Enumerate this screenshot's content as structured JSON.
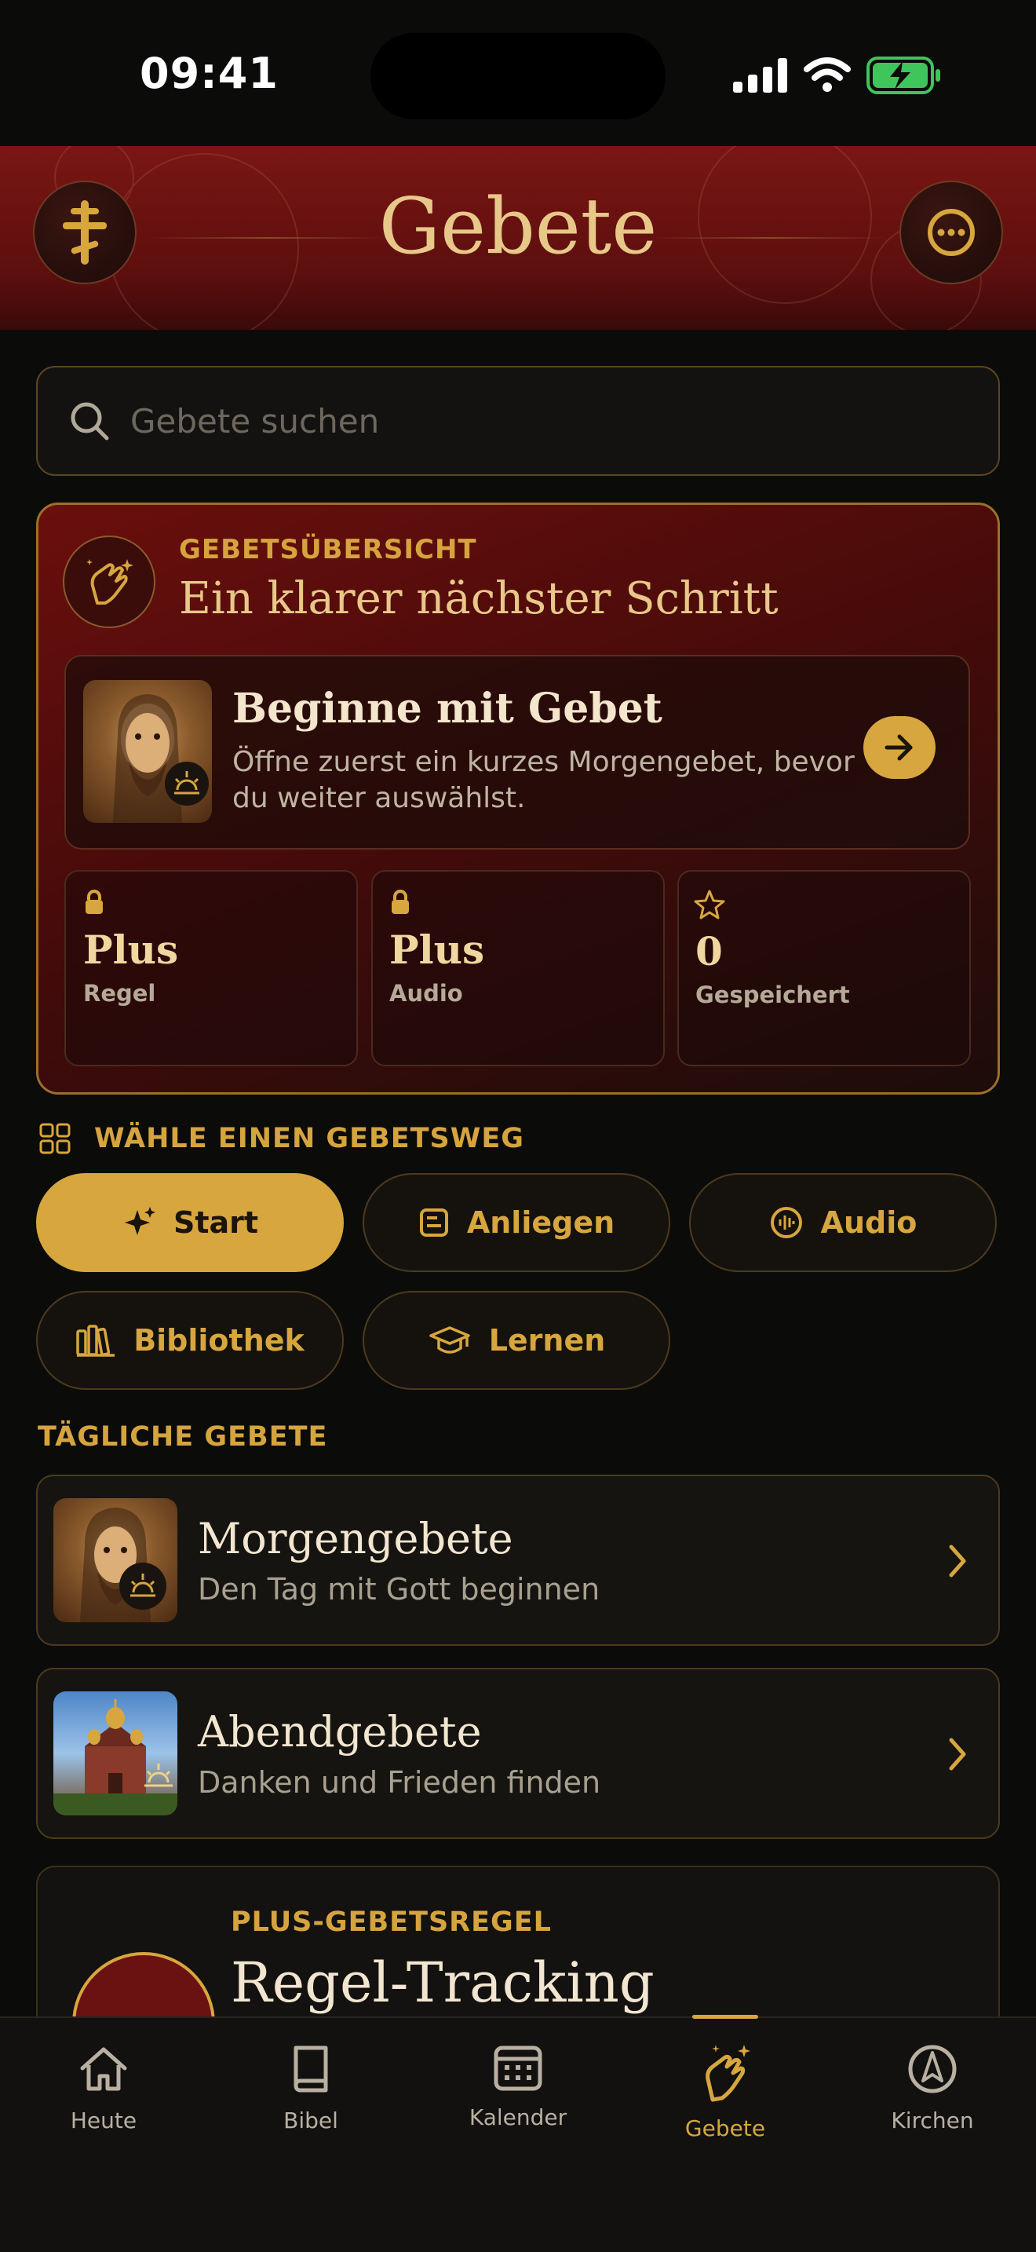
{
  "status_bar": {
    "time": "09:41"
  },
  "header": {
    "title": "Gebete"
  },
  "search": {
    "placeholder": "Gebete suchen"
  },
  "overview": {
    "label": "GEBETSÜBERSICHT",
    "title": "Ein klarer nächster Schritt",
    "begin": {
      "title": "Beginne mit Gebet",
      "subtitle": "Öffne zuerst ein kurzes Morgengebet, bevor du weiter auswählst."
    },
    "stats": [
      {
        "value": "Plus",
        "label": "Regel",
        "icon": "lock-icon"
      },
      {
        "value": "Plus",
        "label": "Audio",
        "icon": "lock-icon"
      },
      {
        "value": "0",
        "label": "Gespeichert",
        "icon": "star-icon"
      }
    ]
  },
  "pathways": {
    "label": "WÄHLE EINEN GEBETSWEG",
    "chips": [
      {
        "label": "Start",
        "icon": "sparkle-icon",
        "active": true
      },
      {
        "label": "Anliegen",
        "icon": "note-icon"
      },
      {
        "label": "Audio",
        "icon": "audio-icon"
      },
      {
        "label": "Bibliothek",
        "icon": "library-icon"
      },
      {
        "label": "Lernen",
        "icon": "graduation-cap-icon"
      }
    ]
  },
  "daily": {
    "label": "TÄGLICHE GEBETE",
    "items": [
      {
        "title": "Morgengebete",
        "subtitle": "Den Tag mit Gott beginnen"
      },
      {
        "title": "Abendgebete",
        "subtitle": "Danken und Frieden finden"
      }
    ]
  },
  "plus_rule": {
    "label": "PLUS-GEBETSREGEL",
    "title": "Regel-Tracking"
  },
  "tabbar": {
    "items": [
      {
        "label": "Heute",
        "icon": "home-icon"
      },
      {
        "label": "Bibel",
        "icon": "book-icon"
      },
      {
        "label": "Kalender",
        "icon": "calendar-icon"
      },
      {
        "label": "Gebete",
        "icon": "praying-hands-icon",
        "active": true
      },
      {
        "label": "Kirchen",
        "icon": "compass-icon"
      }
    ]
  },
  "colors": {
    "accent": "#d7a63e",
    "header_red": "#6a1211",
    "background": "#0b0b0a"
  }
}
